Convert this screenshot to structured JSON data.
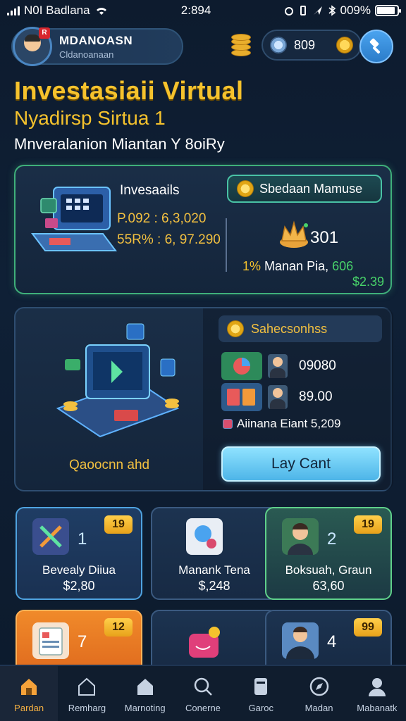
{
  "status_bar": {
    "carrier": "N0I Badlana",
    "time": "2:894",
    "battery": "009%",
    "battery_level": 0.9
  },
  "header": {
    "avatar_badge": "R",
    "profile_name": "MDANOASN",
    "profile_subtitle": "Cldanoanaan",
    "currency_value": "809"
  },
  "title": {
    "main": "Investasiaii Virtual",
    "sub": "Nyadirsp Sirtua 1",
    "description": "Mnveralanion Miantan Y 8oiRy"
  },
  "investment_card": {
    "title": "Invesaails",
    "line1": "P.092 : 6,3,020",
    "line2": "55R% : 6, 97.290",
    "stat_button_label": "Sbedaan Mamuse",
    "crown_value": "301",
    "gain_pct": "1%",
    "gain_label": "Manan Pia,",
    "gain_num": "606",
    "gain_money": "$2.39"
  },
  "holdings_card": {
    "caption": "Qaoocnn ahd",
    "select_label": "Sahecsonhss",
    "row1_value": "09080",
    "row2_value": "89.00",
    "mini_line": "Aiinana Eiant 5,209",
    "cta_label": "Lay Cant"
  },
  "tiles": [
    {
      "badge": "19",
      "count": "1",
      "name": "Bevealy Diiua",
      "price": "$2,80"
    },
    {
      "badge": "",
      "count": "",
      "name": "Manank Tena",
      "price": "$,248"
    },
    {
      "badge": "19",
      "count": "2",
      "name": "Boksuah, Graun",
      "price": "63,60"
    },
    {
      "badge": "12",
      "count": "7",
      "name": "",
      "price": ""
    },
    {
      "badge": "",
      "count": "",
      "name": "",
      "price": ""
    },
    {
      "badge": "99",
      "count": "4",
      "name": "",
      "price": ""
    }
  ],
  "nav": [
    {
      "label": "Pardan",
      "icon": "home-icon"
    },
    {
      "label": "Remharg",
      "icon": "house-outline-icon"
    },
    {
      "label": "Marnoting",
      "icon": "house-filled-icon"
    },
    {
      "label": "Conerne",
      "icon": "search-icon"
    },
    {
      "label": "Garoc",
      "icon": "card-icon"
    },
    {
      "label": "Madan",
      "icon": "compass-icon"
    },
    {
      "label": "Mabanatk",
      "icon": "profile-icon"
    }
  ],
  "colors": {
    "accent_gold": "#f5c22d",
    "accent_green": "#48d36a",
    "background": "#0f2036",
    "cta": "#4db5e8"
  }
}
